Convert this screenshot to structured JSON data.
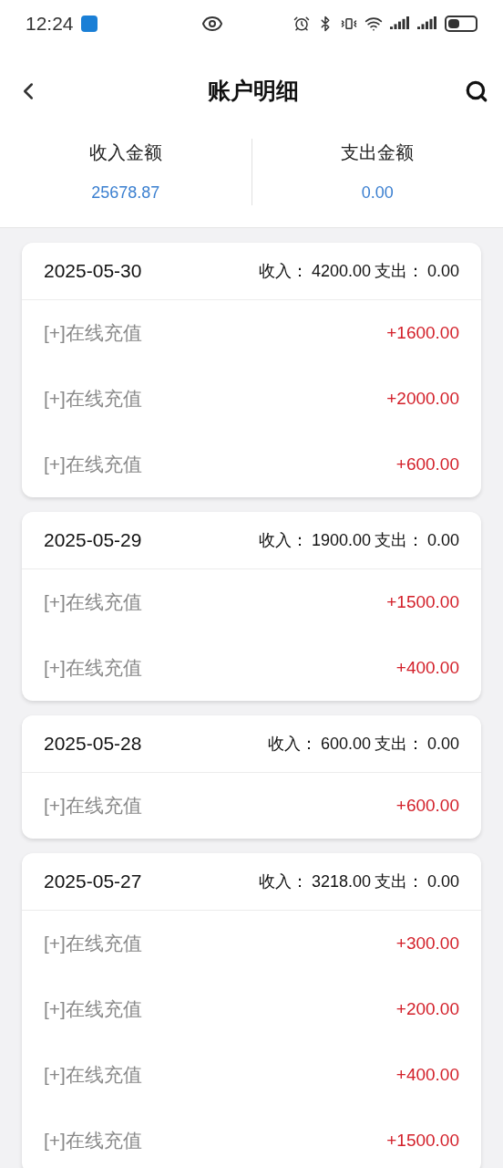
{
  "status_bar": {
    "time": "12:24"
  },
  "header": {
    "title": "账户明细"
  },
  "summary": [
    {
      "label": "收入金额",
      "value": "25678.87"
    },
    {
      "label": "支出金额",
      "value": "0.00"
    }
  ],
  "days": [
    {
      "date": "2025-05-30",
      "income_label": "收入：",
      "income": "4200.00",
      "expense_label": "支出：",
      "expense": "0.00",
      "entries": [
        {
          "name": "[+]在线充值",
          "amount": "+1600.00"
        },
        {
          "name": "[+]在线充值",
          "amount": "+2000.00"
        },
        {
          "name": "[+]在线充值",
          "amount": "+600.00"
        }
      ]
    },
    {
      "date": "2025-05-29",
      "income_label": "收入：",
      "income": "1900.00",
      "expense_label": "支出：",
      "expense": "0.00",
      "entries": [
        {
          "name": "[+]在线充值",
          "amount": "+1500.00"
        },
        {
          "name": "[+]在线充值",
          "amount": "+400.00"
        }
      ]
    },
    {
      "date": "2025-05-28",
      "income_label": "收入：",
      "income": "600.00",
      "expense_label": "支出：",
      "expense": "0.00",
      "entries": [
        {
          "name": "[+]在线充值",
          "amount": "+600.00"
        }
      ]
    },
    {
      "date": "2025-05-27",
      "income_label": "收入：",
      "income": "3218.00",
      "expense_label": "支出：",
      "expense": "0.00",
      "entries": [
        {
          "name": "[+]在线充值",
          "amount": "+300.00"
        },
        {
          "name": "[+]在线充值",
          "amount": "+200.00"
        },
        {
          "name": "[+]在线充值",
          "amount": "+400.00"
        },
        {
          "name": "[+]在线充值",
          "amount": "+1500.00"
        }
      ]
    }
  ]
}
